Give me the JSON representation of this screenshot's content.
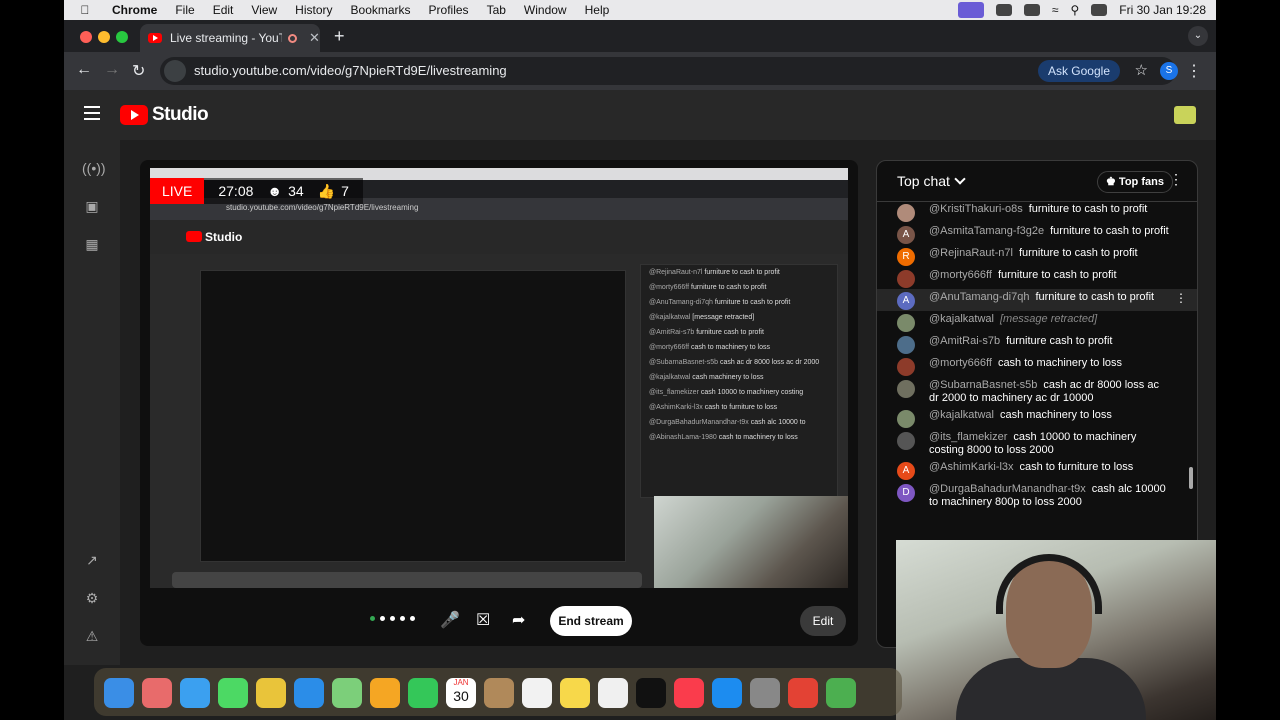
{
  "menubar": {
    "app": "Chrome",
    "items": [
      "File",
      "Edit",
      "View",
      "History",
      "Bookmarks",
      "Profiles",
      "Tab",
      "Window",
      "Help"
    ],
    "datetime": "Fri 30 Jan  19:28"
  },
  "browser": {
    "tab_title": "Live streaming - YouTube",
    "url": "studio.youtube.com/video/g7NpieRTd9E/livestreaming",
    "ask_google": "Ask Google",
    "profile_initial": "S"
  },
  "studio": {
    "logo_text": "Studio"
  },
  "stream": {
    "live_label": "LIVE",
    "elapsed": "27:08",
    "viewers": "34",
    "likes": "7",
    "end_stream_label": "End stream",
    "edit_label": "Edit",
    "inner_url": "studio.youtube.com/video/g7NpieRTd9E/livestreaming",
    "inner_logo": "Studio"
  },
  "inner_chat": [
    {
      "author": "@RejinaRaut-n7l",
      "text": "furniture to cash to profit"
    },
    {
      "author": "@morty666ff",
      "text": "furniture to cash to profit"
    },
    {
      "author": "@AnuTamang-di7qh",
      "text": "furniture to cash to profit"
    },
    {
      "author": "@kajalkatwal",
      "text": "[message retracted]"
    },
    {
      "author": "@AmitRai-s7b",
      "text": "furniture cash to profit"
    },
    {
      "author": "@morty666ff",
      "text": "cash to machinery to loss"
    },
    {
      "author": "@SubarnaBasnet-s5b",
      "text": "cash ac dr 8000 loss ac dr 2000"
    },
    {
      "author": "@kajalkatwal",
      "text": "cash machinery to loss"
    },
    {
      "author": "@its_flamekizer",
      "text": "cash 10000 to machinery costing"
    },
    {
      "author": "@AshimKarki-l3x",
      "text": "cash to furniture to loss"
    },
    {
      "author": "@DurgaBahadurManandhar-t9x",
      "text": "cash alc 10000 to"
    },
    {
      "author": "@AbinashLama-1980",
      "text": "cash to machinery to loss"
    }
  ],
  "chat": {
    "title": "Top chat",
    "top_fans_label": "Top fans",
    "messages": [
      {
        "author": "@KristiThakuri-o8s",
        "text": "furniture to cash to profit",
        "avatar": "",
        "color": "#b08b7a"
      },
      {
        "author": "@AsmitaTamang-f3g2e",
        "text": "furniture to cash to profit",
        "avatar": "A",
        "color": "#795548"
      },
      {
        "author": "@RejinaRaut-n7l",
        "text": "furniture to cash to profit",
        "avatar": "R",
        "color": "#ef6c00"
      },
      {
        "author": "@morty666ff",
        "text": "furniture to cash to profit",
        "avatar": "",
        "color": "#8d3b2a"
      },
      {
        "author": "@AnuTamang-di7qh",
        "text": "furniture to cash to profit",
        "avatar": "A",
        "color": "#5c6bc0"
      },
      {
        "author": "@kajalkatwal",
        "text": "[message retracted]",
        "avatar": "",
        "color": "#7a8a6a"
      },
      {
        "author": "@AmitRai-s7b",
        "text": "furniture cash to profit",
        "avatar": "",
        "color": "#4d6d8a"
      },
      {
        "author": "@morty666ff",
        "text": "cash to machinery to loss",
        "avatar": "",
        "color": "#8d3b2a"
      },
      {
        "author": "@SubarnaBasnet-s5b",
        "text": "cash ac dr 8000 loss ac dr 2000 to machinery ac dr 10000",
        "avatar": "",
        "color": "#6f6f5f"
      },
      {
        "author": "@kajalkatwal",
        "text": "cash machinery to loss",
        "avatar": "",
        "color": "#7a8a6a"
      },
      {
        "author": "@its_flamekizer",
        "text": "cash 10000 to machinery costing 8000 to loss 2000",
        "avatar": "",
        "color": "#555"
      },
      {
        "author": "@AshimKarki-l3x",
        "text": "cash to furniture to loss",
        "avatar": "A",
        "color": "#e64a19"
      },
      {
        "author": "@DurgaBahadurManandhar-t9x",
        "text": "cash alc 10000 to machinery 800p to loss 2000",
        "avatar": "D",
        "color": "#7e57c2"
      }
    ]
  },
  "dock": {
    "calendar_month": "JAN",
    "calendar_day": "30"
  }
}
